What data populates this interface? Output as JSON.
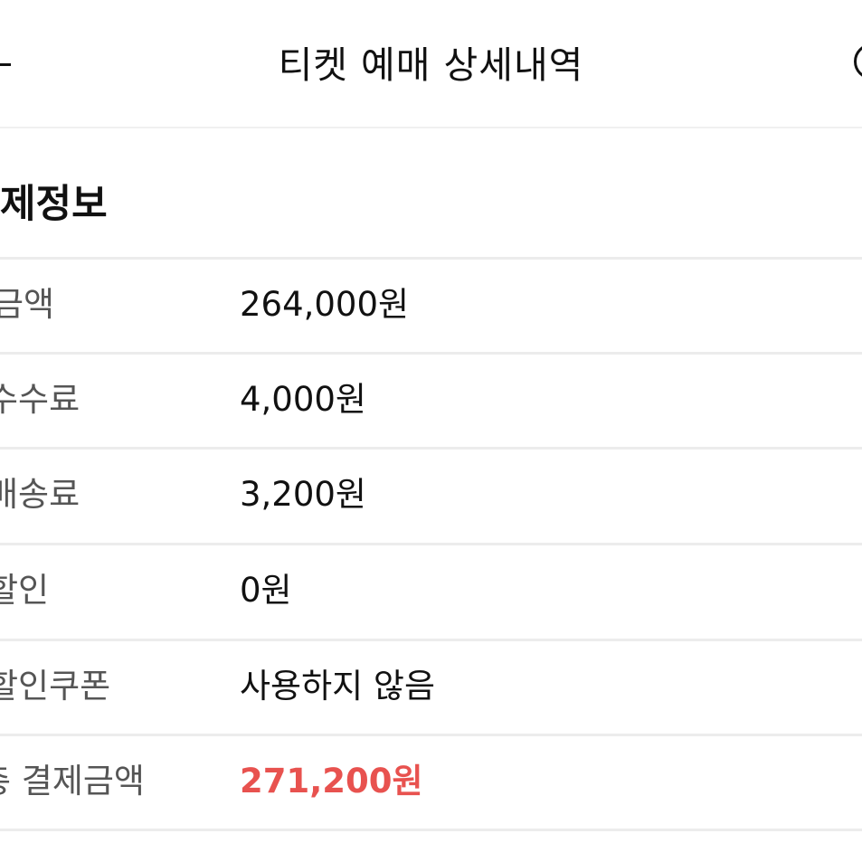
{
  "header": {
    "title": "티켓 예매 상세내역"
  },
  "section": {
    "title": "제정보"
  },
  "rows": [
    {
      "label": "금액",
      "value": "264,000원"
    },
    {
      "label": "수수료",
      "value": "4,000원"
    },
    {
      "label": "배송료",
      "value": "3,200원"
    },
    {
      "label": "할인",
      "value": "0원"
    },
    {
      "label": "할인쿠폰",
      "value": "사용하지 않음"
    },
    {
      "label": "총 결제금액",
      "value": "271,200원"
    }
  ],
  "colors": {
    "total_accent": "#e8524f",
    "label_gray": "#555555",
    "divider": "#ececec"
  },
  "icons": {
    "back": "back-arrow-icon",
    "info": "info-circle-icon"
  }
}
